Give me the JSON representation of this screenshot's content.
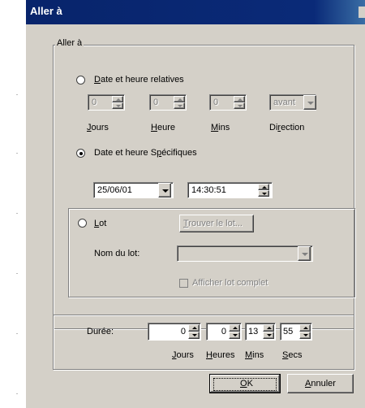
{
  "window": {
    "title": "Aller à"
  },
  "goto_group": {
    "label": "Aller à",
    "relative": {
      "radio_label": "Date et heure relatives",
      "jours_value": "0",
      "heure_value": "0",
      "mins_value": "0",
      "direction_value": "avant",
      "jours_label": "Jours",
      "heure_label": "Heure",
      "mins_label": "Mins",
      "direction_label": "Direction"
    },
    "specific": {
      "radio_label": "Date et heure Spécifiques",
      "date_value": "25/06/01",
      "time_value": "14:30:51"
    },
    "lot": {
      "radio_label": "Lot",
      "find_button": "Trouver le lot...",
      "name_label": "Nom du lot:",
      "name_value": "",
      "show_complete_label": "Afficher lot complet"
    }
  },
  "duration": {
    "label": "Durée:",
    "jours_value": "0",
    "heures_value": "0",
    "mins_value": "13",
    "secs_value": "55",
    "jours_label": "Jours",
    "heures_label": "Heures",
    "mins_label": "Mins",
    "secs_label": "Secs"
  },
  "buttons": {
    "ok": "OK",
    "cancel": "Annuler"
  },
  "selected_mode": "specific"
}
